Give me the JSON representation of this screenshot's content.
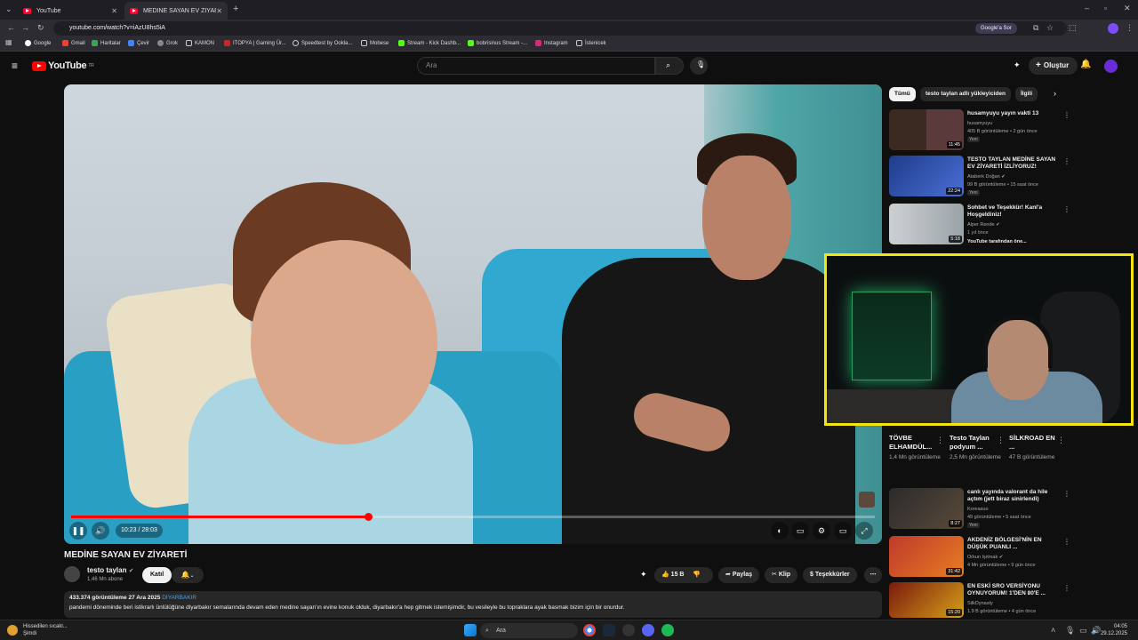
{
  "browser": {
    "tabs": [
      {
        "label": "YouTube"
      },
      {
        "label": "MEDİNE SAYAN EV ZİYARET"
      }
    ],
    "url": "youtube.com/watch?v=iAzU8hs5iA",
    "google_ask": "Google'a Sor",
    "bookmarks": [
      "Google",
      "Gmail",
      "Haritalar",
      "Çevir",
      "Grok",
      "KAMON",
      "ITOPYA | Gaming Ür...",
      "Speedtest by Ookla...",
      "Mobese",
      "Stream - Kick Dashb...",
      "bobrisinus Stream -...",
      "Instagram",
      "İstenicek"
    ]
  },
  "youtube": {
    "logo": "YouTube",
    "logo_region": "TR",
    "search_placeholder": "Ara",
    "create_label": "Oluştur"
  },
  "player": {
    "time_label": "10:23 / 28:03",
    "progress": 0.37,
    "title": "MEDİNE SAYAN EV ZİYARETİ",
    "channel": "testo taylan",
    "subscribers": "1,46 Mn abone",
    "join_label": "Katıl",
    "likes": "15 B",
    "share_label": "Paylaş",
    "clip_label": "Klip",
    "thanks_label": "Teşekkürler",
    "views_date": "433.374 görüntüleme  27 Ara 2025",
    "location_tag": "DİYARBAKIR",
    "description": "pandemi döneminde beri istikrarlı ünlülüğüne diyarbakır semalarında devam eden medine sayan'ın evine konuk olduk, diyarbakır'a hep gitmek istemişimdir, bu vesileyle bu topraklara ayak basmak bizim için bir onurdur."
  },
  "sidebar": {
    "chips": [
      "Tümü",
      "testo taylan adlı yükleyiciden",
      "İlgili"
    ],
    "videos": [
      {
        "title": "husamyuyu yayın vakti 13",
        "channel": "husamyuyu",
        "meta": "405 B görüntüleme • 2 gün önce",
        "badge": "Yeni",
        "duration": "11:45"
      },
      {
        "title": "TESTO TAYLAN MEDİNE SAYAN EV ZİYARETİ İZLİYORUZ!",
        "channel": "Ataberk Doğan",
        "meta": "99 B görüntüleme • 15 saat önce",
        "badge": "Yeni",
        "duration": "22:24"
      },
      {
        "title": "Sohbet ve Teşekkür! Kanl'a Hoşgeldiniz!",
        "channel": "Alper Rende",
        "meta": "1 yıl önce",
        "badge": "YouTube tarafından öne...",
        "duration": "5:18"
      }
    ],
    "shorts": [
      {
        "title": "TÖVBE ELHAMDÜL...",
        "views": "1,4 Mn görüntüleme"
      },
      {
        "title": "Testo Taylan podyum ...",
        "views": "2,5 Mn görüntüleme"
      },
      {
        "title": "SİLKROAD EN ...",
        "views": "47 B görüntüleme"
      }
    ],
    "videos2": [
      {
        "title": "canlı yayında valorant da hile açtım (jett biraz sinirlendi)",
        "channel": "Koreasuo",
        "meta": "49 görüntüleme • 5 saat önce",
        "badge": "Yeni",
        "duration": "8:27"
      },
      {
        "title": "AKDENİZ BÖLGESİ'NİN EN DÜŞÜK PUANLI ...",
        "channel": "Orkun Işıtmak",
        "meta": "4 Mn görüntüleme • 9 gün önce",
        "badge": "",
        "duration": "31:42"
      },
      {
        "title": "EN ESKİ SRO VERSİYONU OYNUYORUM! 1'DEN 80'E ...",
        "channel": "SilkDynasty",
        "meta": "1,9 B görüntüleme • 4 gün önce",
        "badge": "",
        "duration": "15:20"
      }
    ]
  },
  "taskbar": {
    "weather_title": "Hissedilen sıcakl...",
    "weather_sub": "Şimdi",
    "search": "Ara",
    "time": "04:05",
    "date": "29.12.2025"
  }
}
